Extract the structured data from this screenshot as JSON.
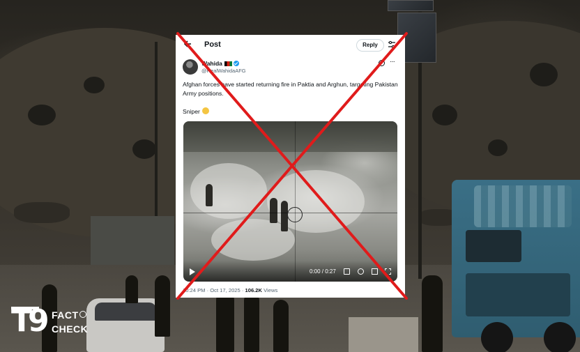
{
  "header": {
    "title": "Post",
    "reply_label": "Reply"
  },
  "tweet": {
    "author_name": "Wahida",
    "author_handle": "@RealWahidaAFG",
    "text": "Afghan forces have started returning fire in Paktia and Arghun, targeting Pakistan Army positions.",
    "tag": "Sniper",
    "timestamp": "10:24 PM · Oct 17, 2025 ·",
    "views_count": "106.2K",
    "views_label": "Views"
  },
  "video": {
    "timecode": "0:00 / 0:27"
  },
  "icons": {
    "back": "back-arrow-icon",
    "tune": "sliders-icon",
    "verified": "verified-badge-icon",
    "flag": "afghanistan-flag-icon",
    "grok": "grok-icon",
    "more": "more-icon",
    "play": "play-icon",
    "volume": "volume-icon",
    "settings": "settings-icon",
    "fullscreen": "fullscreen-icon",
    "emoji": "scream-emoji-icon"
  },
  "logo": {
    "number": "T9",
    "line1": "FACT",
    "line2": "CHECK"
  },
  "colors": {
    "x_mark": "#e01b1b",
    "verified": "#1d9bf0",
    "text": "#0f1419",
    "muted": "#536471"
  }
}
